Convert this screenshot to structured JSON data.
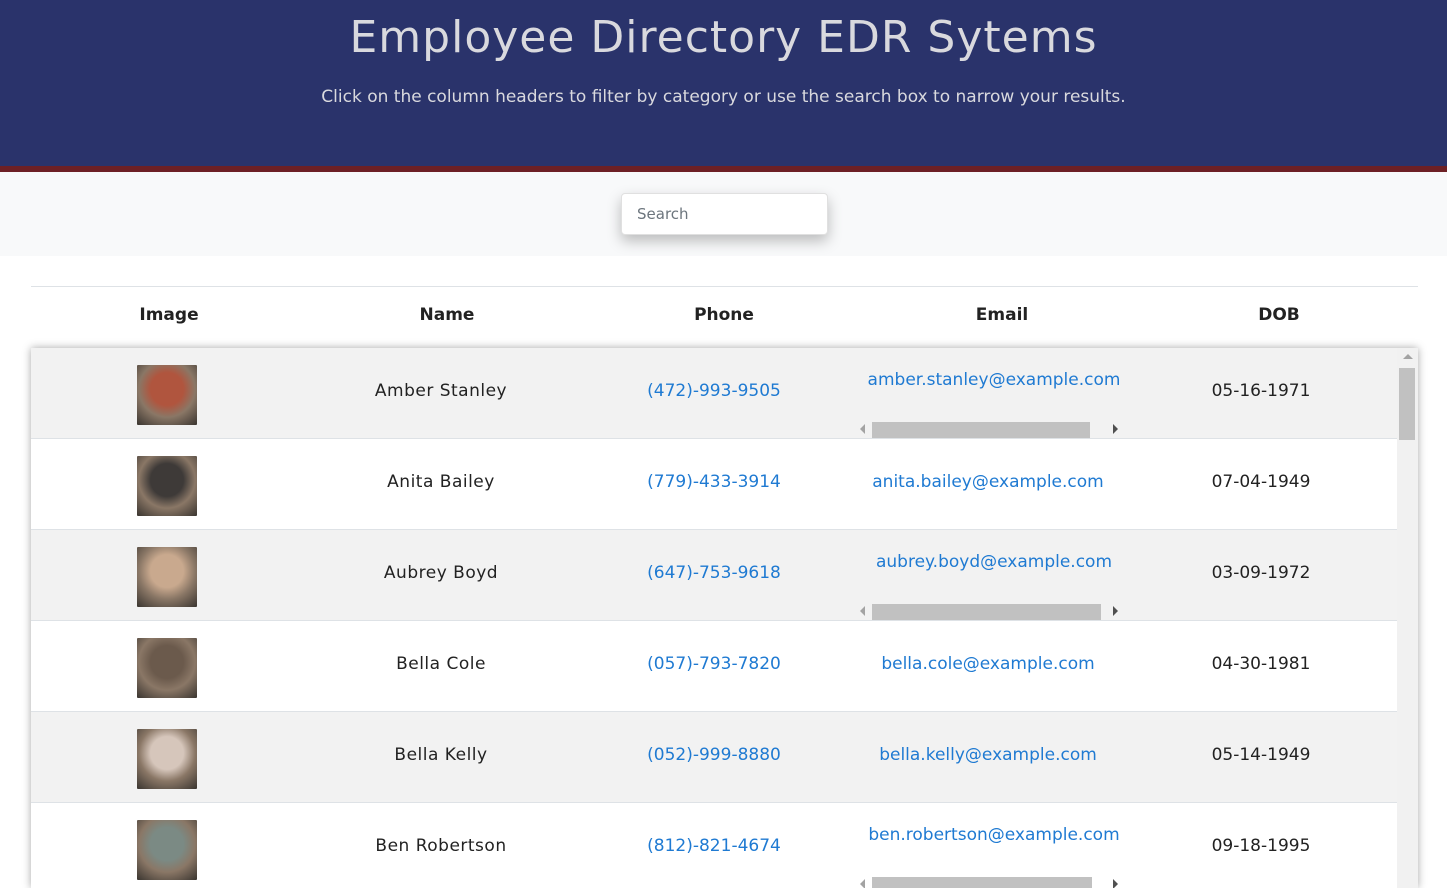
{
  "header": {
    "title": "Employee Directory EDR Sytems",
    "subtitle": "Click on the column headers to filter by category or use the search box to narrow your results."
  },
  "search": {
    "placeholder": "Search",
    "value": ""
  },
  "table": {
    "columns": [
      "Image",
      "Name",
      "Phone",
      "Email",
      "DOB"
    ],
    "rows": [
      {
        "name": "Amber Stanley",
        "phone": "(472)-993-9505",
        "email": "amber.stanley@example.com",
        "dob": "05-16-1971",
        "avatar_color": "#b0553e"
      },
      {
        "name": "Anita Bailey",
        "phone": "(779)-433-3914",
        "email": "anita.bailey@example.com",
        "dob": "07-04-1949",
        "avatar_color": "#3e3a38"
      },
      {
        "name": "Aubrey Boyd",
        "phone": "(647)-753-9618",
        "email": "aubrey.boyd@example.com",
        "dob": "03-09-1972",
        "avatar_color": "#c9a98e"
      },
      {
        "name": "Bella Cole",
        "phone": "(057)-793-7820",
        "email": "bella.cole@example.com",
        "dob": "04-30-1981",
        "avatar_color": "#6b5a4c"
      },
      {
        "name": "Bella Kelly",
        "phone": "(052)-999-8880",
        "email": "bella.kelly@example.com",
        "dob": "05-14-1949",
        "avatar_color": "#d6c6bb"
      },
      {
        "name": "Ben Robertson",
        "phone": "(812)-821-4674",
        "email": "ben.robertson@example.com",
        "dob": "09-18-1995",
        "avatar_color": "#7b8a84"
      }
    ]
  },
  "colors": {
    "header_bg": "#2a336b",
    "header_border": "#6d2025",
    "link": "#1f7ad2"
  }
}
